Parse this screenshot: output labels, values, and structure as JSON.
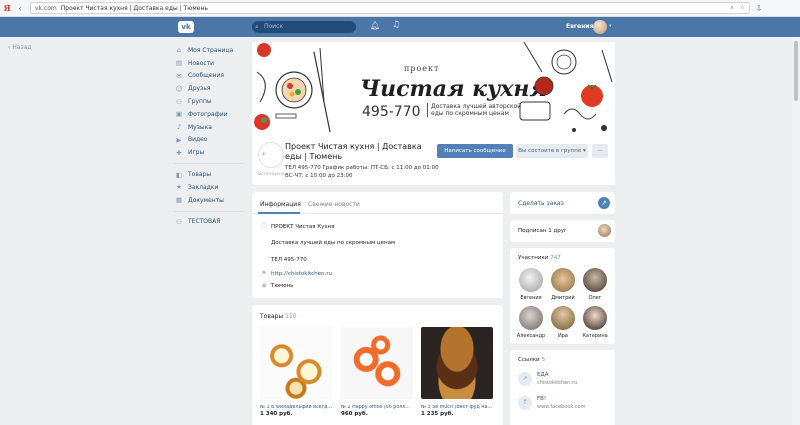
{
  "browser": {
    "host": "vk.com",
    "title": "Проект Чистая кухня | Доставка еды | Тюмень"
  },
  "header": {
    "search_placeholder": "Поиск",
    "user_name": "Евгения"
  },
  "back_label": "Назад",
  "menu": {
    "main": [
      {
        "label": "Моя Страница",
        "icon": "home-icon"
      },
      {
        "label": "Новости",
        "icon": "news-icon"
      },
      {
        "label": "Сообщения",
        "icon": "messages-icon"
      },
      {
        "label": "Друзья",
        "icon": "friends-icon"
      },
      {
        "label": "Группы",
        "icon": "groups-icon"
      },
      {
        "label": "Фотографии",
        "icon": "photos-icon"
      },
      {
        "label": "Музыка",
        "icon": "music-icon"
      },
      {
        "label": "Видео",
        "icon": "video-icon"
      },
      {
        "label": "Игры",
        "icon": "games-icon"
      }
    ],
    "extra": [
      {
        "label": "Товары",
        "icon": "goods-icon"
      },
      {
        "label": "Закладки",
        "icon": "bookmark-icon"
      },
      {
        "label": "Документы",
        "icon": "docs-icon"
      }
    ],
    "app": {
      "label": "ТЕСТОВАЯ",
      "icon": "app-icon"
    }
  },
  "cover": {
    "brand_small": "проект",
    "brand_big": "Чистая кухня",
    "phone": "495-770",
    "tagline": "Доставка лучшей авторской еды по скромным ценам"
  },
  "group": {
    "avatar_subtitle": "Чистая кухня",
    "name": "Проект Чистая кухня | Доставка еды | Тюмень",
    "info_line1": "ТЕЛ 495-770 График работы: ПТ-СБ: с 11:00 до 01:00",
    "info_line2": "ВС-ЧТ: с 10:00 до 23:00",
    "btn_message": "Написать сообщение",
    "btn_member": "Вы состоите в группе",
    "btn_more": "···"
  },
  "info": {
    "tab_info": "Информация",
    "tab_news": "Свежие новости",
    "title": "ПРОЕКТ Чистая Кухня",
    "desc": "Доставка лучшей еды по скромным ценам",
    "phone": "ТЕЛ 495-770",
    "site": "http://chistokitchen.ru",
    "city": "Тюмень"
  },
  "goods": {
    "title": "Товары",
    "count": "110",
    "items": [
      {
        "name": "№ 1 В Филадельфии всегд...",
        "price": "1 340 руб."
      },
      {
        "name": "№ 2 Happy office (56 ролл...",
        "price": "960 руб."
      },
      {
        "name": "№ 3 So much (Вест фуд на...",
        "price": "1 235 руб."
      }
    ]
  },
  "order": {
    "label": "Сделать заказ"
  },
  "subscribed": {
    "label": "Подписан 1 друг"
  },
  "members": {
    "title": "Участники",
    "count": "747",
    "people": [
      {
        "name": "Евгения"
      },
      {
        "name": "Дмитрий"
      },
      {
        "name": "Олег"
      },
      {
        "name": "Александр"
      },
      {
        "name": "Ира"
      },
      {
        "name": "Катерина"
      }
    ]
  },
  "links": {
    "title": "Ссылки",
    "count": "5",
    "items": [
      {
        "title": "ЕДА",
        "sub": "chistokitchen.ru"
      },
      {
        "title": "FB!",
        "sub": "www.facebook.com"
      }
    ]
  }
}
